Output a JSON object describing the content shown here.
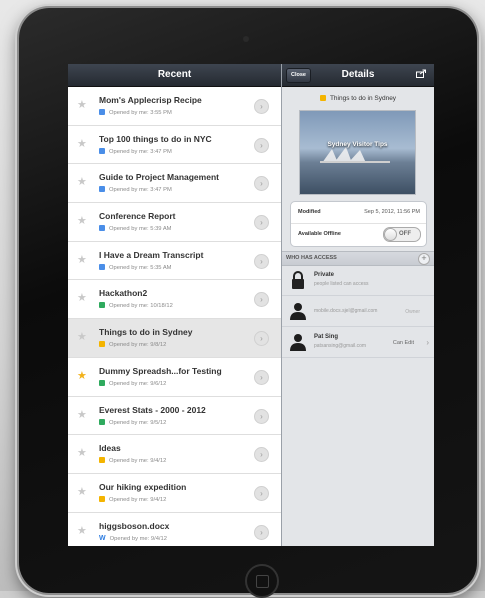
{
  "left_pane": {
    "title": "Recent",
    "items": [
      {
        "title": "Mom's Applecrisp Recipe",
        "subtitle": "Opened by me: 3:55 PM",
        "icon": "doc",
        "starred": false,
        "selected": false
      },
      {
        "title": "Top 100 things to do in NYC",
        "subtitle": "Opened by me: 3:47 PM",
        "icon": "doc",
        "starred": false,
        "selected": false
      },
      {
        "title": "Guide to Project Management",
        "subtitle": "Opened by me: 3:47 PM",
        "icon": "doc",
        "starred": false,
        "selected": false
      },
      {
        "title": "Conference Report",
        "subtitle": "Opened by me: 5:39 AM",
        "icon": "doc",
        "starred": false,
        "selected": false
      },
      {
        "title": "I Have a Dream Transcript",
        "subtitle": "Opened by me: 5:35 AM",
        "icon": "doc",
        "starred": false,
        "selected": false
      },
      {
        "title": "Hackathon2",
        "subtitle": "Opened by me: 10/18/12",
        "icon": "sheet",
        "starred": false,
        "selected": false
      },
      {
        "title": "Things to do in Sydney",
        "subtitle": "Opened by me: 9/8/12",
        "icon": "pres",
        "starred": false,
        "selected": true
      },
      {
        "title": "Dummy Spreadsh...for Testing",
        "subtitle": "Opened by me: 9/6/12",
        "icon": "sheet",
        "starred": true,
        "selected": false
      },
      {
        "title": "Everest Stats - 2000 - 2012",
        "subtitle": "Opened by me: 9/5/12",
        "icon": "sheet",
        "starred": false,
        "selected": false
      },
      {
        "title": "Ideas",
        "subtitle": "Opened by me: 9/4/12",
        "icon": "pres",
        "starred": false,
        "selected": false
      },
      {
        "title": "Our hiking expedition",
        "subtitle": "Opened by me: 9/4/12",
        "icon": "pres",
        "starred": false,
        "selected": false
      },
      {
        "title": "higgsboson.docx",
        "subtitle": "Opened by me: 9/4/12",
        "icon": "file",
        "starred": false,
        "selected": false
      }
    ]
  },
  "details": {
    "title": "Details",
    "close_label": "Close",
    "doc_title": "Things to do in Sydney",
    "thumb_text": "Sydney Visitor Tips",
    "modified_label": "Modified",
    "modified_value": "Sep 5, 2012, 11:56 PM",
    "offline_label": "Available Offline",
    "offline_state": "OFF",
    "access_header": "WHO HAS ACCESS",
    "access": [
      {
        "name": "Private",
        "detail": "people listed can access",
        "role": "",
        "kind": "lock"
      },
      {
        "name": "",
        "detail": "mobile.docs.sjel@gmail.com",
        "role": "Owner",
        "kind": "person"
      },
      {
        "name": "Pat Sing",
        "detail": "patsansing@gmail.com",
        "role": "Can Edit",
        "kind": "person"
      }
    ]
  },
  "colors": {
    "star_on": "#f2b21b",
    "doc": "#4a8ee8",
    "pres": "#f4b400",
    "sheet": "#2faa5e"
  }
}
